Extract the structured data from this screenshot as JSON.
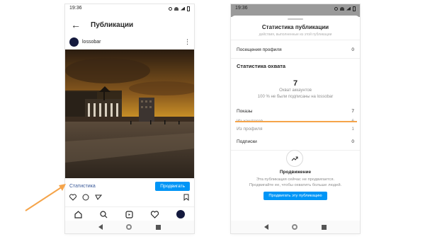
{
  "left": {
    "status_time": "19:36",
    "title": "Публикации",
    "username": "lossobar",
    "stats_link": "Статистика",
    "promote_button": "Продвигать"
  },
  "right": {
    "status_time": "19:36",
    "sheet_title": "Статистика публикации",
    "cut_text": "действия, выполненные из этой публикации",
    "profile_visits_label": "Посещения профиля",
    "profile_visits_value": "0",
    "reach_section_title": "Статистика охвата",
    "reach_value": "7",
    "reach_label": "Охват аккаунтов",
    "reach_note": "100 % не были подписаны на lossobar",
    "impressions_label": "Показы",
    "impressions_value": "7",
    "from_hashtags_label": "Из хэштегов",
    "from_hashtags_value": "6",
    "from_profile_label": "Из профиля",
    "from_profile_value": "1",
    "follows_label": "Подписки",
    "follows_value": "0",
    "promo_title": "Продвижение",
    "promo_desc": "Эта публикация сейчас не продвигается. Продвигайте ее, чтобы охватить больше людей.",
    "promo_button": "Продвигать эту публикацию"
  },
  "colors": {
    "accent_blue": "#0095f6",
    "link_blue": "#385898",
    "annotation_orange": "#f5a44a"
  },
  "icons": [
    "back-arrow-icon",
    "more-icon",
    "heart-icon",
    "comment-icon",
    "share-icon",
    "bookmark-icon",
    "home-icon",
    "search-icon",
    "reels-icon",
    "activity-icon",
    "trend-icon"
  ]
}
